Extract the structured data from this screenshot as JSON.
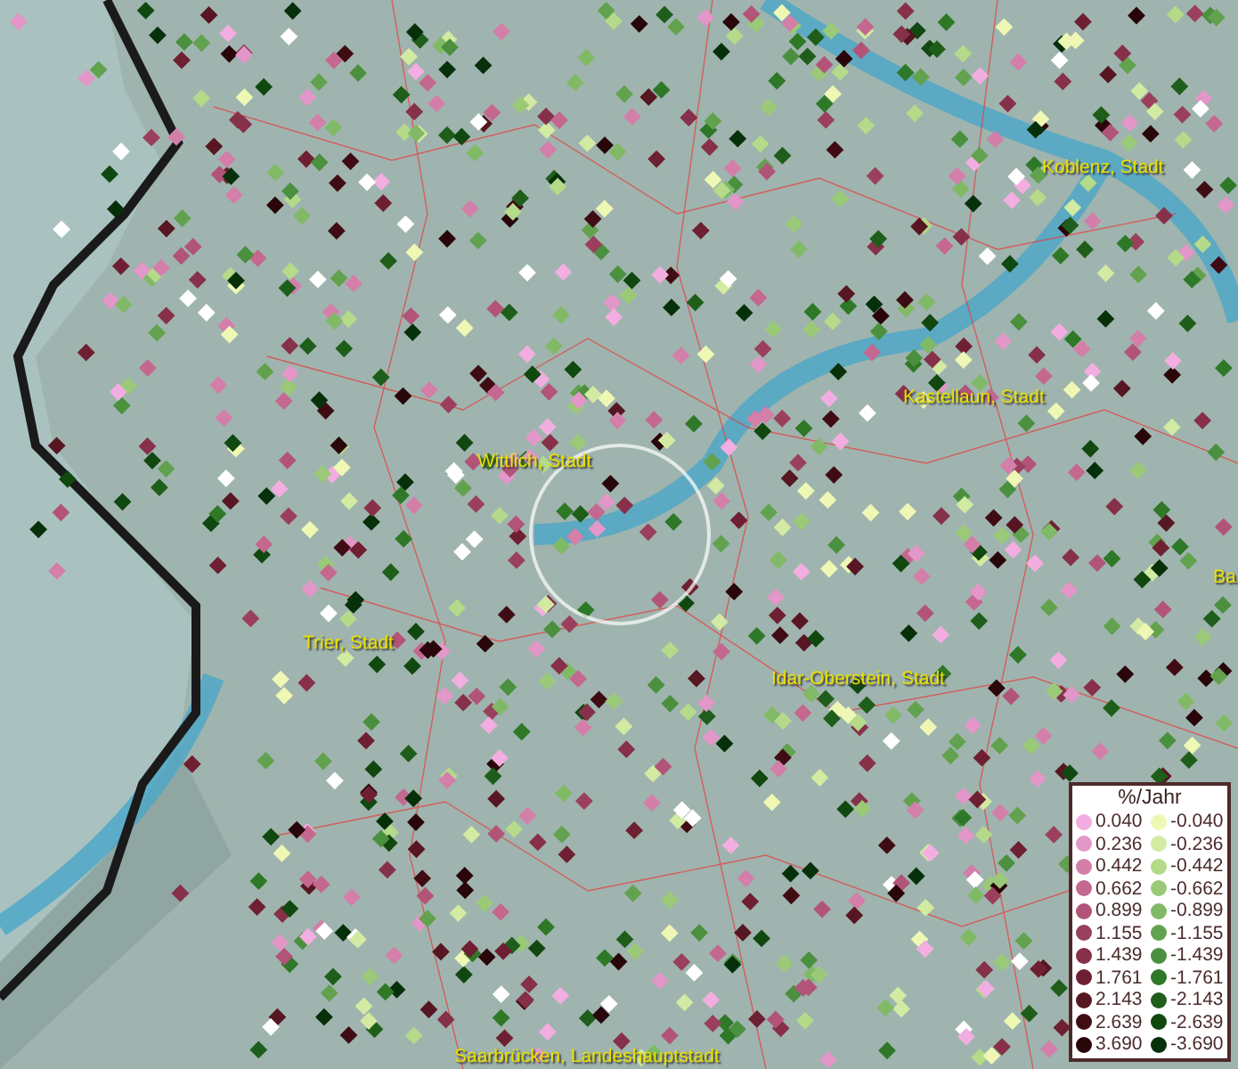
{
  "map": {
    "places": [
      {
        "name": "Koblenz, Stadt"
      },
      {
        "name": "Kastellaun, Stadt"
      },
      {
        "name": "Wittlich, Stadt"
      },
      {
        "name": "Trier, Stadt"
      },
      {
        "name": "Idar-Oberstein, Stadt"
      },
      {
        "name": "Ba"
      },
      {
        "name": "Saarbrücken, Landeshauptstadt"
      }
    ]
  },
  "legend": {
    "title": "%/Jahr",
    "positive": [
      {
        "label": "0.040",
        "color": "#f2aee0"
      },
      {
        "label": "0.236",
        "color": "#e396c8"
      },
      {
        "label": "0.442",
        "color": "#d47eaa"
      },
      {
        "label": "0.662",
        "color": "#c46890"
      },
      {
        "label": "0.899",
        "color": "#b25478"
      },
      {
        "label": "1.155",
        "color": "#9a405c"
      },
      {
        "label": "1.439",
        "color": "#86304a"
      },
      {
        "label": "1.761",
        "color": "#6e2032"
      },
      {
        "label": "2.143",
        "color": "#561622"
      },
      {
        "label": "2.639",
        "color": "#400c14"
      },
      {
        "label": "3.690",
        "color": "#28060a"
      }
    ],
    "negative": [
      {
        "label": "-0.040",
        "color": "#eef8b4"
      },
      {
        "label": "-0.236",
        "color": "#d2eaa2"
      },
      {
        "label": "-0.442",
        "color": "#b4da8a"
      },
      {
        "label": "-0.662",
        "color": "#9aca78"
      },
      {
        "label": "-0.899",
        "color": "#80ba66"
      },
      {
        "label": "-1.155",
        "color": "#62a24e"
      },
      {
        "label": "-1.439",
        "color": "#4a903e"
      },
      {
        "label": "-1.761",
        "color": "#2e7828"
      },
      {
        "label": "-2.143",
        "color": "#1e5e1a"
      },
      {
        "label": "-2.639",
        "color": "#104810"
      },
      {
        "label": "-3.690",
        "color": "#06300a"
      }
    ]
  }
}
